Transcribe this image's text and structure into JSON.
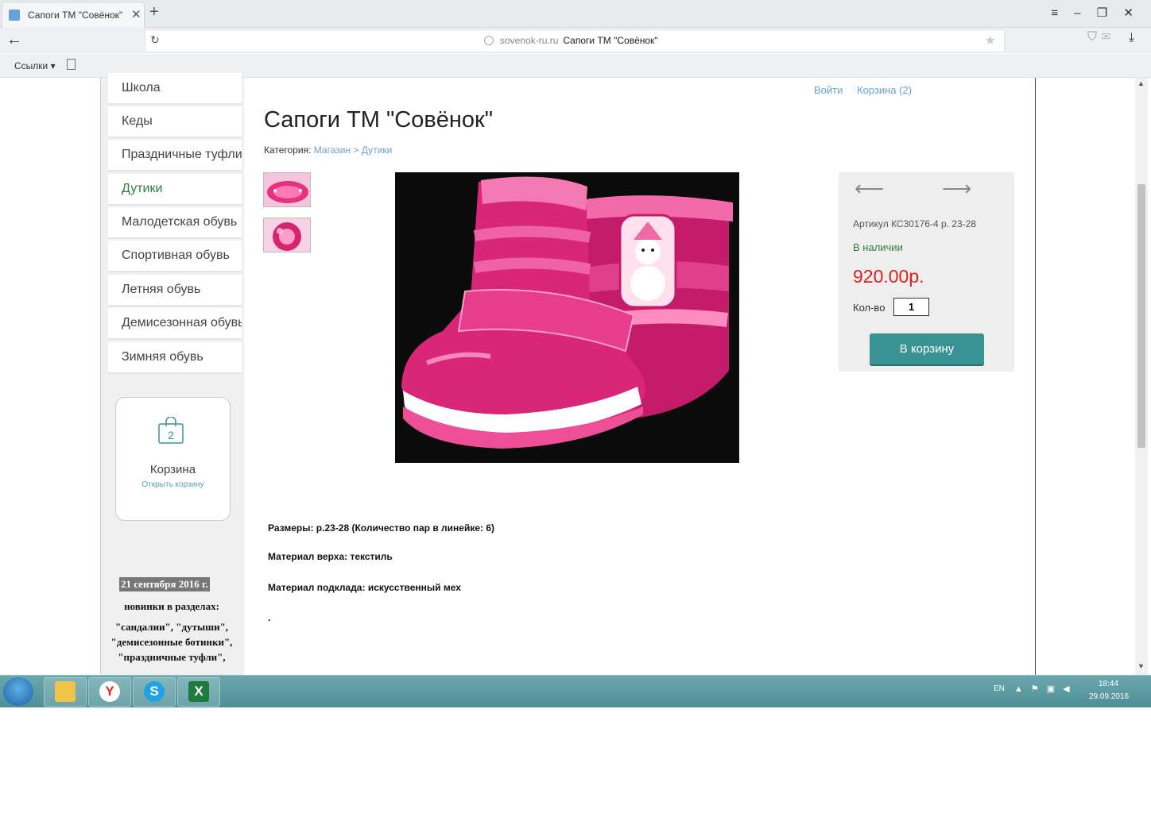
{
  "browser": {
    "tab_title": "Сапоги ТМ \"Совёнок\"",
    "url_domain": "sovenok-ru.ru",
    "url_title": "Сапоги ТМ \"Совёнок\"",
    "bookmarks_label": "Ссылки ▾"
  },
  "sidebar": {
    "menu": [
      {
        "label": "Школа"
      },
      {
        "label": "Кеды"
      },
      {
        "label": "Праздничные туфли"
      },
      {
        "label": "Дутики"
      },
      {
        "label": "Малодетская обувь"
      },
      {
        "label": "Спортивная обувь"
      },
      {
        "label": "Летняя обувь"
      },
      {
        "label": "Демисезонная обувь"
      },
      {
        "label": "Зимняя обувь"
      }
    ],
    "cart": {
      "count": "2",
      "title": "Корзина",
      "link": "Открыть корзину"
    },
    "news": {
      "date": "21 сентября 2016 г.",
      "line1": "новинки в разделах:",
      "line2": "\"сандалии\", \"дутыши\", \"демисезонные ботинки\", \"праздничные туфли\","
    }
  },
  "header": {
    "login": "Войти",
    "cart": "Корзина (2)"
  },
  "product": {
    "title": "Сапоги ТМ \"Совёнок\"",
    "category_label": "Категория:",
    "category_path": "Магазин > Дутики",
    "sku": "Артикул КС30176-4 р. 23-28",
    "stock": "В наличии",
    "price": "920.00р.",
    "qty_label": "Кол-во",
    "qty_value": "1",
    "buy_label": "В корзину",
    "desc": [
      "Размеры: р.23-28 (Количество пар в линейке: 6)",
      "Материал верха: текстиль",
      "Материал подклада: искусственный мех",
      "."
    ]
  },
  "taskbar": {
    "lang": "EN",
    "time": "18:44",
    "date": "29.09.2016"
  },
  "colors": {
    "accent": "#3a9393",
    "price": "#e02020",
    "link": "#6b9fd0",
    "stock": "#2e7d3e",
    "taskbar": "#5a9ba2"
  }
}
